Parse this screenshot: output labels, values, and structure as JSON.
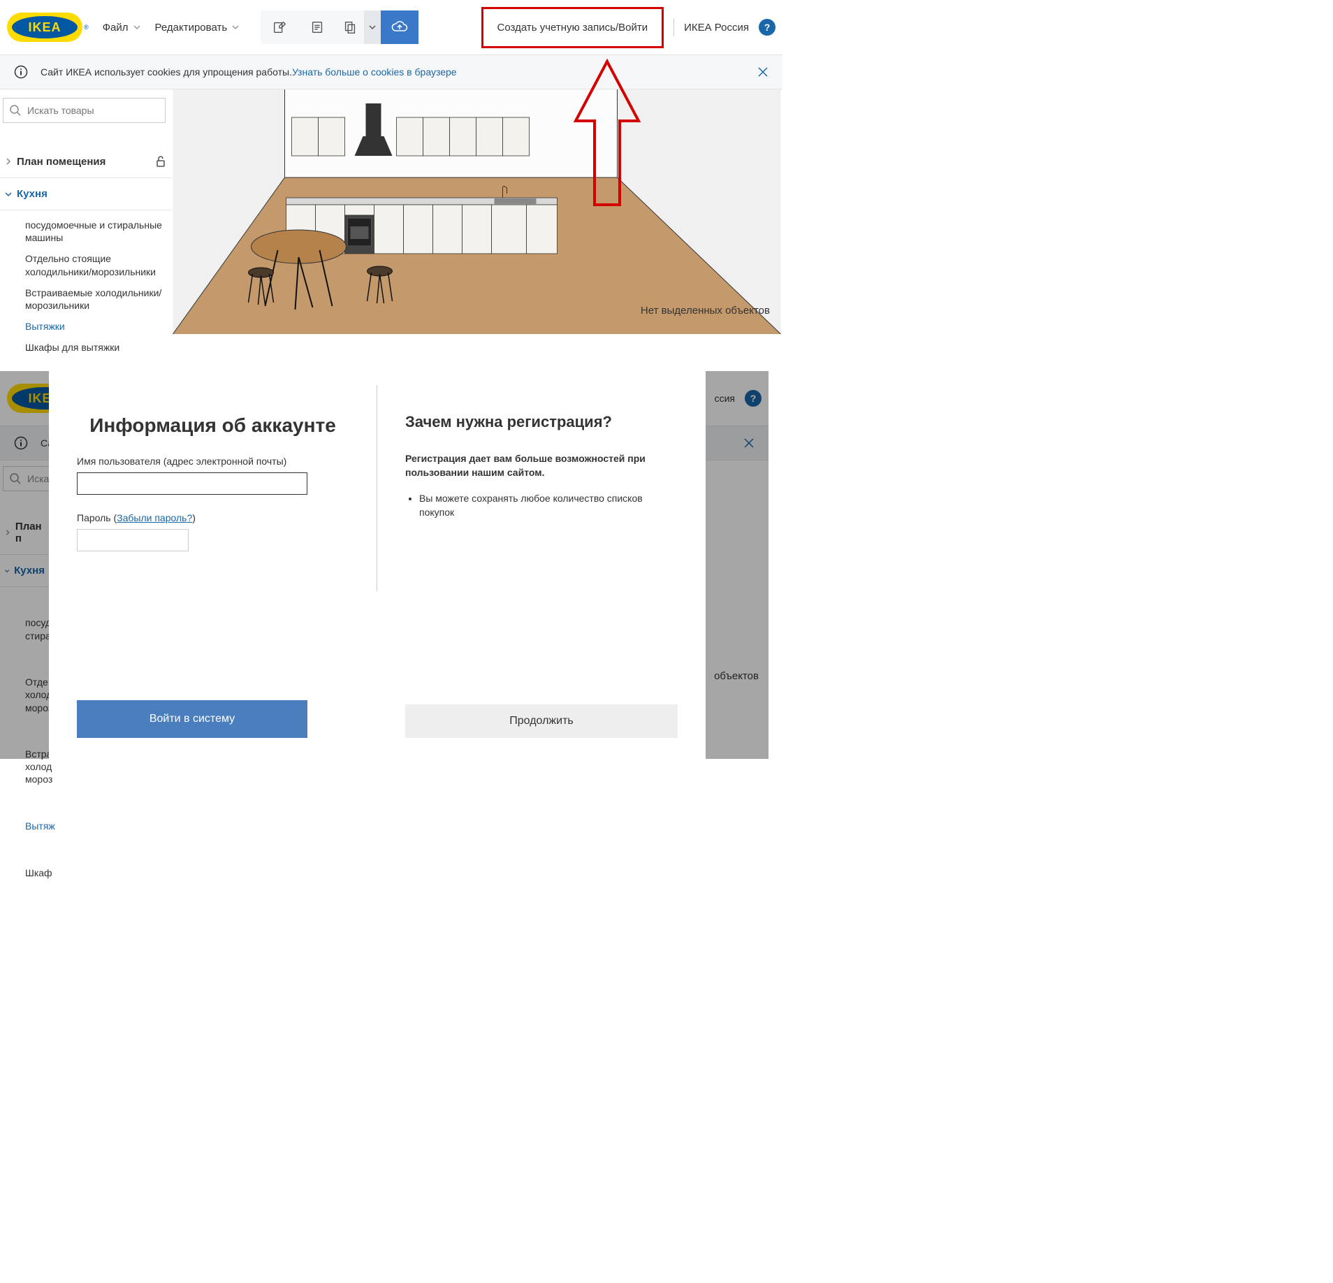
{
  "logo_text": "IKEA",
  "header": {
    "file": "Файл",
    "edit": "Редактировать",
    "signin": "Создать учетную запись/Войти",
    "region": "ИКЕА Россия",
    "help": "?"
  },
  "cookie": {
    "info_icon": "ⓘ",
    "text": "Сайт ИКЕА использует cookies для упрощения работы. ",
    "link": "Узнать больше о cookies в браузере"
  },
  "search": {
    "placeholder": "Искать товары"
  },
  "panel": {
    "plan": "План помещения",
    "kitchen": "Кухня"
  },
  "categories": [
    "посудомоечные и стиральные машины",
    "Отдельно стоящие холодильники/морозильники",
    "Встраиваемые холодильники/морозильники",
    "Вытяжки",
    "Шкафы для вытяжки"
  ],
  "active_category_index": 3,
  "status_right": "Нет выделенных объектов",
  "modal": {
    "left_title": "Информация об аккаунте",
    "username_label": "Имя пользователя (адрес электронной почты)",
    "password_label_pre": "Пароль (",
    "password_forgot": "Забыли пароль?",
    "password_label_post": ")",
    "login_btn": "Войти в систему",
    "right_title": "Зачем нужна регистрация?",
    "right_sub": "Регистрация дает вам больше возможностей при пользовании нашим сайтом.",
    "bullet1": "Вы можете сохранять любое количество списков покупок",
    "continue_btn": "Продолжить"
  },
  "bg": {
    "cookie_prefix": "Са",
    "search_prefix": "Иска",
    "plan_prefix": "План п",
    "kitchen": "Кухня",
    "cat0": "посуд\nстира.",
    "cat1": "Отде\nхолод\nмороз",
    "cat2": "Встра\nхолод\nмороз",
    "cat3": "Вытяж",
    "cat4": "Шкаф",
    "region_suffix": "ссия",
    "objects_suffix": " объектов"
  }
}
